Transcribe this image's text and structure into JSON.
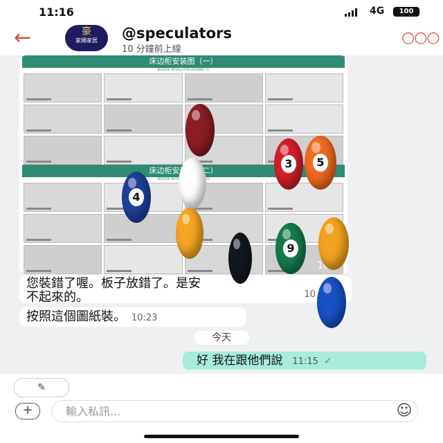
{
  "status_bar": {
    "time": "11:16",
    "network": "4G",
    "battery": "100"
  },
  "header": {
    "back_icon": "arrow-left-icon",
    "avatar_logo": "豪",
    "avatar_brand": "家順家居",
    "title": "@speculators",
    "subtitle": "10 分鐘前上線",
    "more_icon": "more-dots-icon"
  },
  "chat": {
    "image_panels": [
      {
        "heading": "床边柜安装图（一）",
        "sub": "BEDSIDE INSTALLATION DRAWING (1)"
      },
      {
        "heading": "床边柜安装图（二）",
        "sub": "BEDSIDE INSTALLATION DRAWING (2)"
      }
    ],
    "image_time": "10:2",
    "messages": [
      {
        "text_line1": "您裝錯了喔。板子放錯了。是安",
        "text_line2": "不起來的。",
        "time": "10"
      },
      {
        "text": "按照這個圖紙裝。",
        "time": "10:23"
      },
      {
        "text": "好 我在跟他們說",
        "time": "11:15"
      }
    ],
    "day_label": "今天"
  },
  "balls": [
    {
      "number": "4",
      "color": "#1f3f9a"
    },
    {
      "number": "",
      "color": "#ffffff"
    },
    {
      "number": "",
      "color": "#f5a623"
    },
    {
      "number": "",
      "color": "#8b1e24"
    },
    {
      "number": "3",
      "color": "#d31f2b"
    },
    {
      "number": "5",
      "color": "#f06a22"
    },
    {
      "number": "9",
      "color": "#157a4d"
    },
    {
      "number": "",
      "color": "#f3a220"
    },
    {
      "number": "",
      "color": "#121820"
    },
    {
      "number": "",
      "color": "#1851c4"
    }
  ],
  "footer": {
    "edit_icon": "pencil-icon",
    "input_placeholder": "輸入私訊...",
    "add_icon": "plus-icon",
    "emoji_icon": "smiley-icon"
  }
}
